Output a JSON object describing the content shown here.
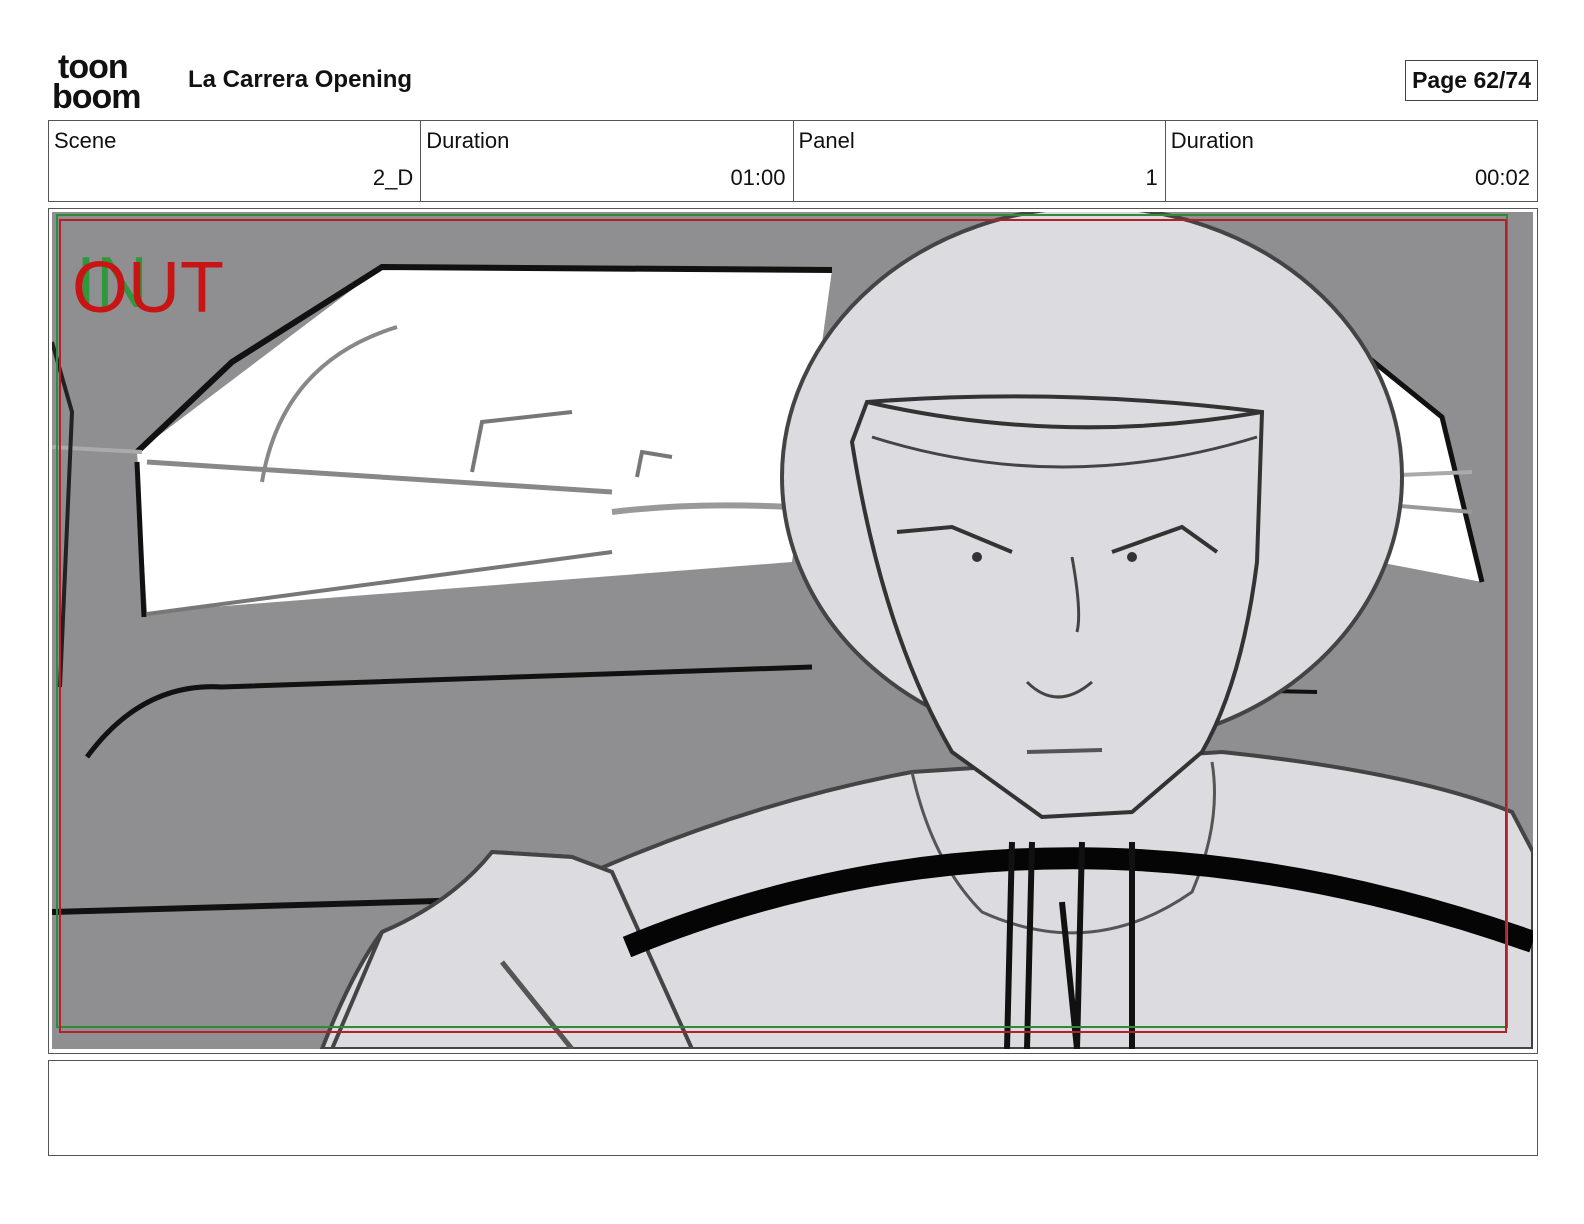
{
  "header": {
    "logo_top": "toon",
    "logo_bottom": "boom",
    "project_title": "La Carrera Opening",
    "page_label": "Page 62/74"
  },
  "info": {
    "scene_label": "Scene",
    "scene_value": "2_D",
    "scene_duration_label": "Duration",
    "scene_duration_value": "01:00",
    "panel_label": "Panel",
    "panel_value": "1",
    "panel_duration_label": "Duration",
    "panel_duration_value": "00:02"
  },
  "panel": {
    "overlay_in": "IN",
    "overlay_out": "OUT",
    "in_color": "#1e9b2e",
    "out_color": "#c81414",
    "safe_frame_red": "#b3202a",
    "safe_frame_green": "#2e8b3a"
  },
  "notes": {
    "text": ""
  }
}
